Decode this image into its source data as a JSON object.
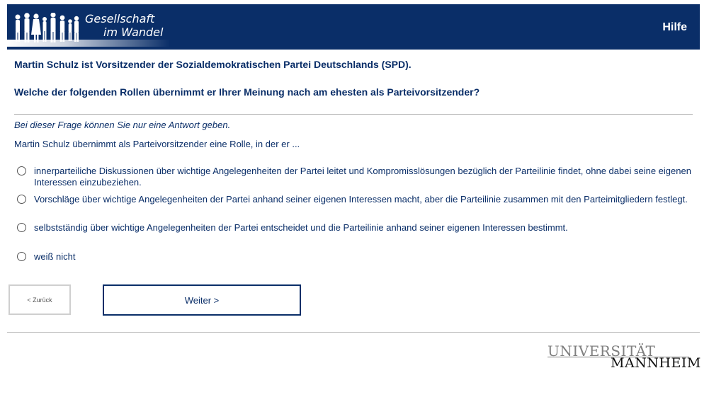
{
  "header": {
    "logo_line1": "Gesellschaft",
    "logo_line2": "im Wandel",
    "help_label": "Hilfe"
  },
  "question": {
    "intro": "Martin Schulz ist Vorsitzender der Sozialdemokratischen Partei Deutschlands (SPD).",
    "text": "Welche der folgenden Rollen übernimmt er Ihrer Meinung nach am ehesten als Parteivorsitzender?",
    "instruction": "Bei dieser Frage können Sie nur eine Antwort geben.",
    "stem": "Martin Schulz übernimmt als Parteivorsitzender eine Rolle, in der er ..."
  },
  "options": [
    {
      "label": "innerparteiliche Diskussionen über wichtige Angelegenheiten der Partei leitet und Kompromisslösungen bezüglich der Parteilinie findet, ohne dabei seine eigenen Interessen einzubeziehen.",
      "selected": false
    },
    {
      "label": "Vorschläge über wichtige Angelegenheiten der Partei anhand seiner eigenen Interessen macht, aber die Parteilinie zusammen mit den Parteimitgliedern festlegt.",
      "selected": false
    },
    {
      "label": "selbstständig über wichtige Angelegenheiten der Partei entscheidet und die Parteilinie anhand seiner eigenen Interessen bestimmt.",
      "selected": false
    },
    {
      "label": "weiß nicht",
      "selected": false
    }
  ],
  "navigation": {
    "back_label": "< Zurück",
    "next_label": "Weiter >"
  },
  "footer": {
    "university_line1": "UNIVERSITÄT",
    "university_line2": "MANNHEIM"
  },
  "colors": {
    "header_bg": "#0a2e68",
    "text_primary": "#0a2e68",
    "rule": "#b8b8b8"
  }
}
